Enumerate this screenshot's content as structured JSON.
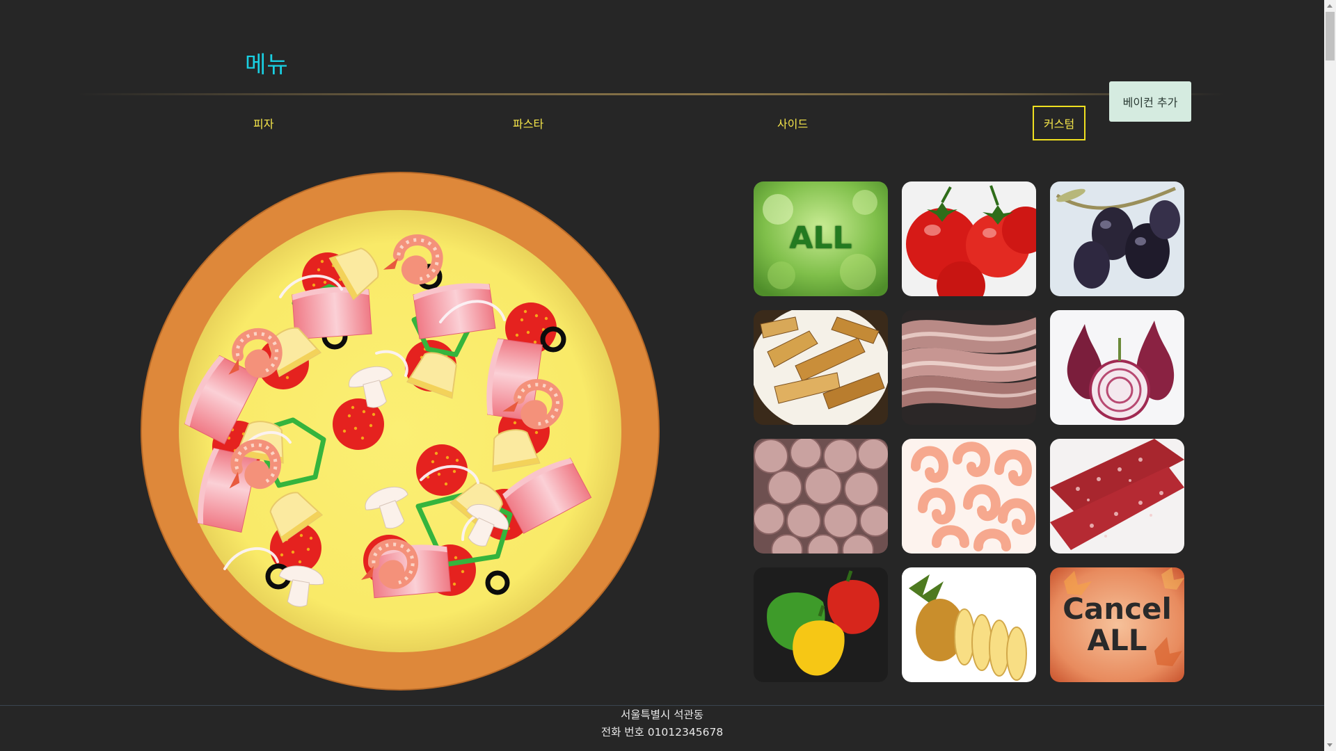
{
  "header": {
    "title": "메뉴"
  },
  "tabs": [
    {
      "label": "피자",
      "active": false
    },
    {
      "label": "파스타",
      "active": false
    },
    {
      "label": "사이드",
      "active": false
    },
    {
      "label": "커스텀",
      "active": true
    }
  ],
  "add_button": {
    "label": "베이컨 추가"
  },
  "toppings": [
    {
      "name": "all",
      "label": "ALL"
    },
    {
      "name": "tomato",
      "label": ""
    },
    {
      "name": "olive",
      "label": ""
    },
    {
      "name": "potato",
      "label": ""
    },
    {
      "name": "bacon",
      "label": ""
    },
    {
      "name": "onion",
      "label": ""
    },
    {
      "name": "mushroom",
      "label": ""
    },
    {
      "name": "shrimp",
      "label": ""
    },
    {
      "name": "salami",
      "label": ""
    },
    {
      "name": "pepper",
      "label": ""
    },
    {
      "name": "pineapple",
      "label": ""
    },
    {
      "name": "cancel-all",
      "label": "Cancel ALL"
    }
  ],
  "footer": {
    "address": "서울특별시 석관동",
    "phone": "전화 번호 01012345678"
  },
  "colors": {
    "title": "#19d0e3",
    "tab_text": "#f6e64a",
    "active_border": "#f0e020",
    "background": "#262626",
    "crust": "#de883a",
    "cheese": "#f8ec6c"
  }
}
